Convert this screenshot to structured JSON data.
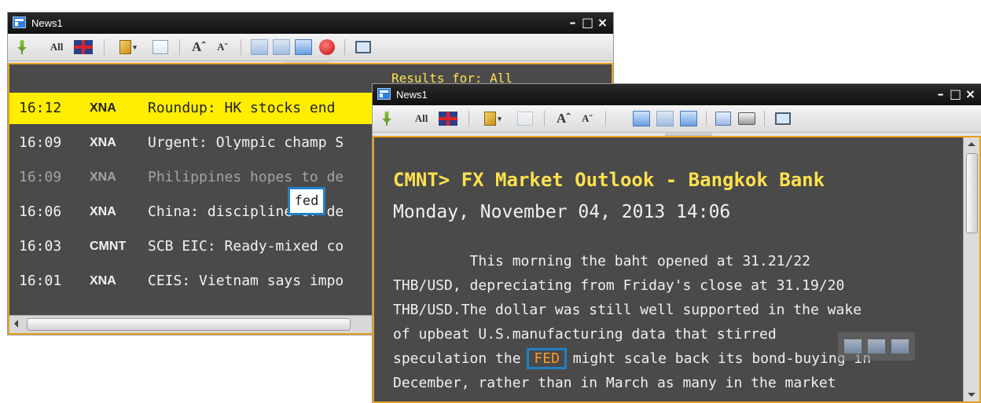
{
  "window1": {
    "title": "News1",
    "controls": {
      "minimize": "–",
      "maximize": "□",
      "close": "×"
    },
    "toolbar": {
      "all_label": "All",
      "font_increase": "Aˆ",
      "font_decrease": "Aˇ"
    },
    "results_label": "Results for: All",
    "rows": [
      {
        "time": "16:12",
        "source": "XNA",
        "headline": "Roundup: HK stocks end",
        "state": "selected"
      },
      {
        "time": "16:09",
        "source": "XNA",
        "headline": "Urgent: Olympic champ S",
        "state": "normal"
      },
      {
        "time": "16:09",
        "source": "XNA",
        "headline": "Philippines hopes to de",
        "state": "read"
      },
      {
        "time": "16:06",
        "source": "XNA",
        "headline": "China: discipline or de",
        "state": "normal"
      },
      {
        "time": "16:03",
        "source": "CMNT",
        "headline": "SCB EIC: Ready-mixed co",
        "state": "normal"
      },
      {
        "time": "16:01",
        "source": "XNA",
        "headline": "CEIS: Vietnam says impo",
        "state": "normal"
      }
    ],
    "tooltip": "fed"
  },
  "window2": {
    "title": "News1",
    "controls": {
      "minimize": "–",
      "maximize": "□",
      "close": "×"
    },
    "toolbar": {
      "all_label": "All",
      "font_increase": "Aˆ",
      "font_decrease": "Aˇ"
    },
    "article": {
      "headline": "CMNT> FX Market Outlook - Bangkok Bank",
      "dateline": "Monday, November 04, 2013 14:06",
      "lines": [
        "         This morning the baht opened at 31.21/22",
        "THB/USD, depreciating from Friday's close at 31.19/20",
        "THB/USD.The dollar was still well supported in the wake",
        "of upbeat U.S.manufacturing data that stirred"
      ],
      "line5_before": "speculation the ",
      "highlight": "FED",
      "line5_after": " might scale back its bond-buying in",
      "line6": "December, rather than in March as many in the market"
    }
  },
  "colors": {
    "pane_bg": "#4a4a4a",
    "selected_row": "#ffee00",
    "accent_border": "#e8a020",
    "headline": "#ffe14d",
    "highlight_border": "#1f80c8"
  }
}
